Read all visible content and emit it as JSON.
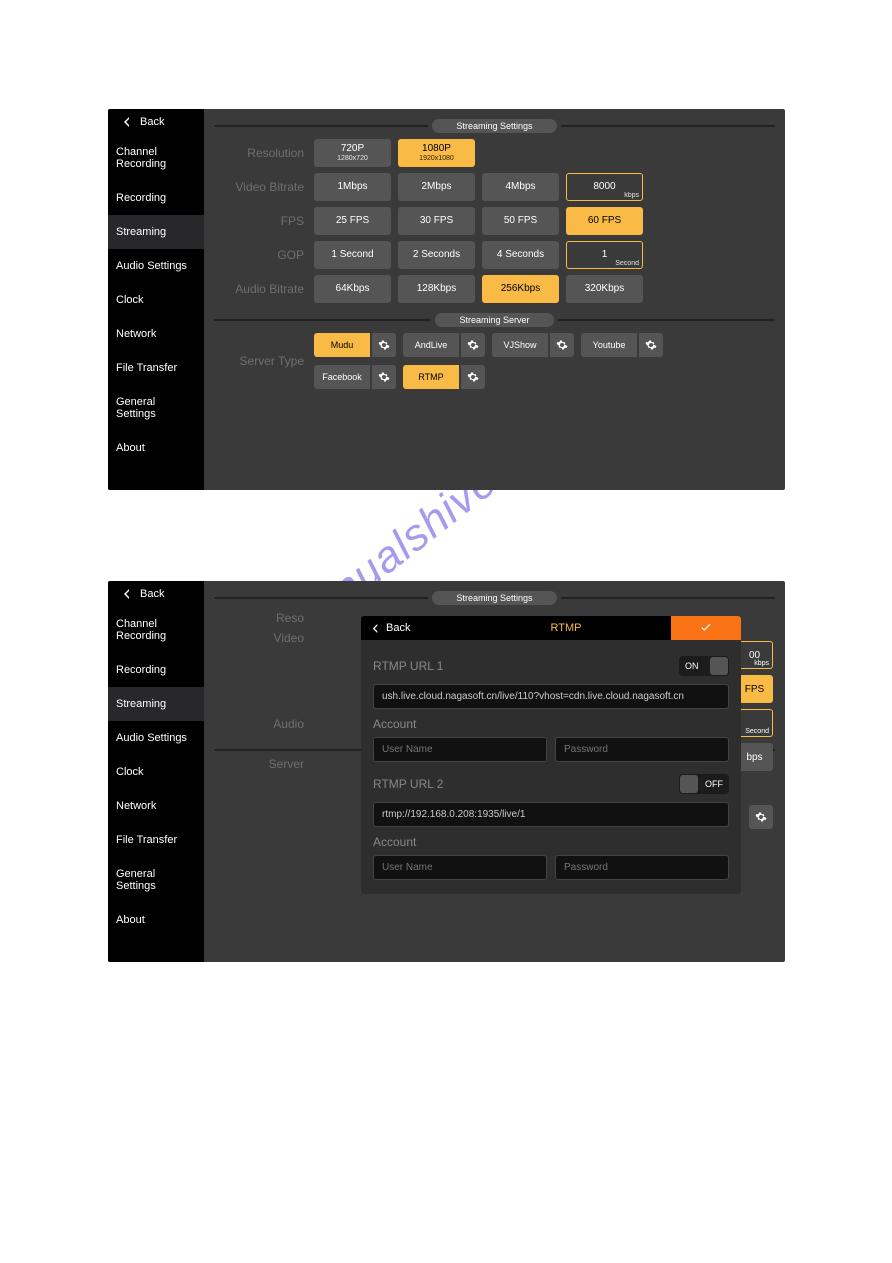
{
  "sidebar": {
    "back": "Back",
    "items": [
      "Channel Recording",
      "Recording",
      "Streaming",
      "Audio Settings",
      "Clock",
      "Network",
      "File Transfer",
      "General Settings",
      "About"
    ],
    "activeIndex": 2
  },
  "headers": {
    "settings": "Streaming Settings",
    "server": "Streaming Server"
  },
  "rows": {
    "resolution": {
      "label": "Resolution",
      "opts": [
        {
          "main": "720P",
          "sub": "1280x720",
          "sel": false
        },
        {
          "main": "1080P",
          "sub": "1920x1080",
          "sel": true
        }
      ]
    },
    "videoBitrate": {
      "label": "Video Bitrate",
      "opts": [
        {
          "main": "1Mbps"
        },
        {
          "main": "2Mbps"
        },
        {
          "main": "4Mbps"
        },
        {
          "main": "8000",
          "unit": "kbps",
          "outline": true
        }
      ]
    },
    "fps": {
      "label": "FPS",
      "opts": [
        {
          "main": "25 FPS"
        },
        {
          "main": "30 FPS"
        },
        {
          "main": "50 FPS"
        },
        {
          "main": "60 FPS",
          "sel": true
        }
      ]
    },
    "gop": {
      "label": "GOP",
      "opts": [
        {
          "main": "1 Second"
        },
        {
          "main": "2 Seconds"
        },
        {
          "main": "4 Seconds"
        },
        {
          "main": "1",
          "unit": "Second",
          "outline": true
        }
      ]
    },
    "audioBitrate": {
      "label": "Audio Bitrate",
      "opts": [
        {
          "main": "64Kbps"
        },
        {
          "main": "128Kbps"
        },
        {
          "main": "256Kbps",
          "sel": true
        },
        {
          "main": "320Kbps"
        }
      ]
    },
    "serverType": {
      "label": "Server Type",
      "row1": [
        {
          "l": "Mudu",
          "sel": true
        },
        {
          "l": "AndLive"
        },
        {
          "l": "VJShow"
        },
        {
          "l": "Youtube"
        }
      ],
      "row2": [
        {
          "l": "Facebook"
        },
        {
          "l": "RTMP",
          "sel": true
        }
      ]
    }
  },
  "shot2": {
    "rowLabels": [
      "Reso",
      "Video",
      "Audio",
      "Server"
    ],
    "peek": {
      "bitrate": "00",
      "bitrateUnit": "kbps",
      "fps": "FPS",
      "gop": "Second",
      "audio": "bps"
    }
  },
  "modal": {
    "back": "Back",
    "title": "RTMP",
    "url1": {
      "label": "RTMP URL 1",
      "toggle": "ON",
      "on": true,
      "value": "ush.live.cloud.nagasoft.cn/live/110?vhost=cdn.live.cloud.nagasoft.cn"
    },
    "url2": {
      "label": "RTMP URL 2",
      "toggle": "OFF",
      "on": false,
      "value": "rtmp://192.168.0.208:1935/live/1"
    },
    "accountLabel": "Account",
    "userPH": "User Name",
    "passPH": "Password"
  },
  "watermark": "manualshive.com"
}
